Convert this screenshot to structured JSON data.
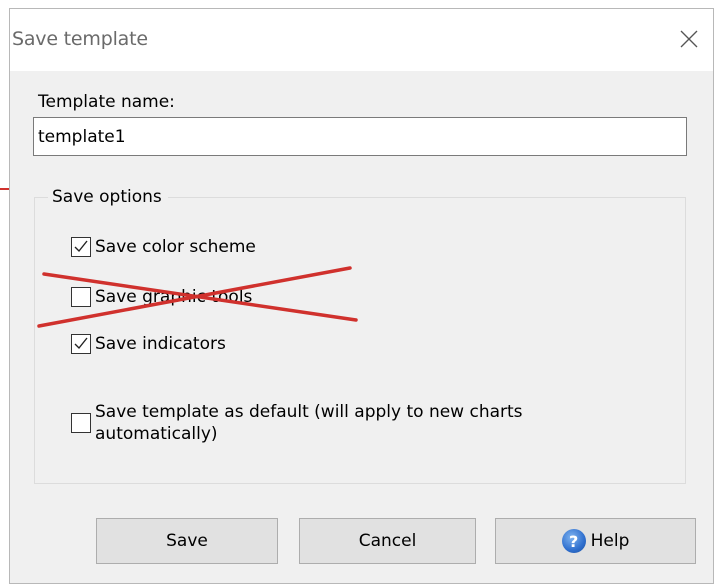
{
  "dialog": {
    "title": "Save template",
    "close_icon": "close-x-icon"
  },
  "template_name": {
    "label": "Template name:",
    "value": "template1"
  },
  "save_options": {
    "legend": "Save options",
    "options": [
      {
        "label": "Save color scheme",
        "checked": true
      },
      {
        "label": "Save graphic tools",
        "checked": false,
        "annotation": "red-cross-strike"
      },
      {
        "label": "Save indicators",
        "checked": true
      },
      {
        "label": "Save template as default (will apply to new charts",
        "label_line2": "automatically)",
        "checked": false
      }
    ]
  },
  "buttons": {
    "save": "Save",
    "cancel": "Cancel",
    "help": "Help",
    "help_icon": "question-icon"
  },
  "colors": {
    "annotation_red": "#d0312d",
    "dialog_bg": "#f0f0f0",
    "button_bg": "#e1e1e1"
  }
}
